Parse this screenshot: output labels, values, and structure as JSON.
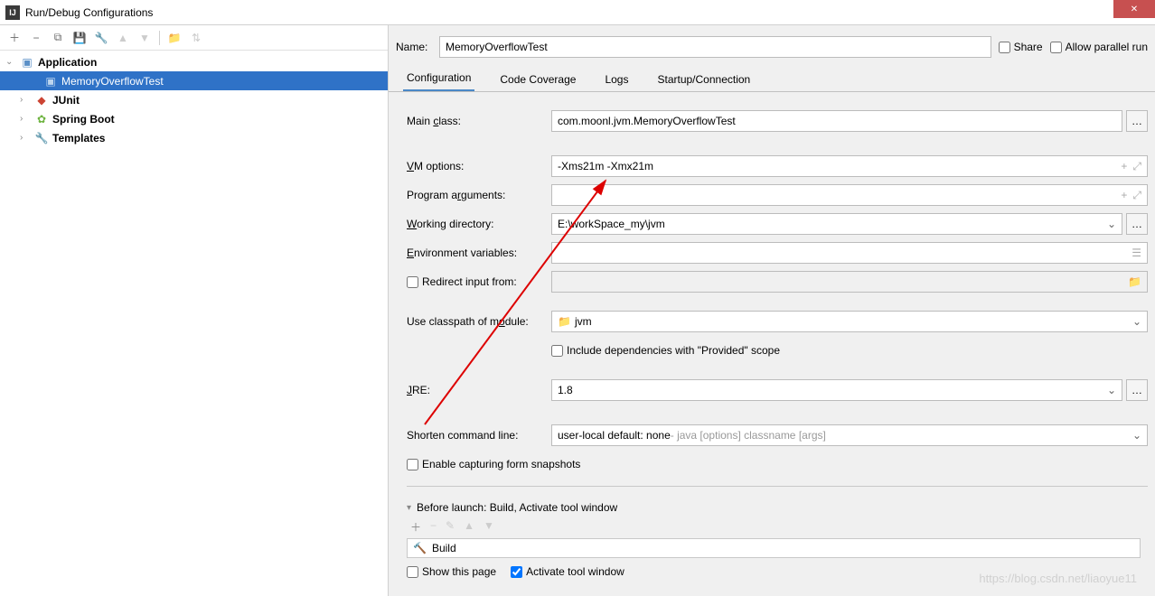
{
  "window": {
    "title": "Run/Debug Configurations"
  },
  "tree": {
    "root": "Application",
    "selected": "MemoryOverflowTest",
    "items": [
      "JUnit",
      "Spring Boot",
      "Templates"
    ]
  },
  "header": {
    "name_label": "Name:",
    "name_value": "MemoryOverflowTest",
    "share_label": "Share",
    "parallel_label": "Allow parallel run"
  },
  "tabs": {
    "items": [
      "Configuration",
      "Code Coverage",
      "Logs",
      "Startup/Connection"
    ],
    "active": 0
  },
  "form": {
    "main_class_label": "Main class:",
    "main_class_value": "com.moonl.jvm.MemoryOverflowTest",
    "vm_options_label": "VM options:",
    "vm_options_value": "-Xms21m -Xmx21m",
    "program_args_label": "Program arguments:",
    "program_args_value": "",
    "working_dir_label": "Working directory:",
    "working_dir_value": "E:\\workSpace_my\\jvm",
    "env_vars_label": "Environment variables:",
    "env_vars_value": "",
    "redirect_input_label": "Redirect input from:",
    "use_classpath_label": "Use classpath of module:",
    "use_classpath_value": "jvm",
    "include_provided_label": "Include dependencies with \"Provided\" scope",
    "jre_label": "JRE:",
    "jre_value": "1.8",
    "shorten_label": "Shorten command line:",
    "shorten_value": "user-local default: none",
    "shorten_hint": " - java [options] classname [args]",
    "enable_snapshots_label": "Enable capturing form snapshots"
  },
  "before_launch": {
    "header": "Before launch: Build, Activate tool window",
    "item": "Build",
    "show_this_page": "Show this page",
    "activate_tool_window": "Activate tool window"
  },
  "watermark": "https://blog.csdn.net/liaoyue11"
}
